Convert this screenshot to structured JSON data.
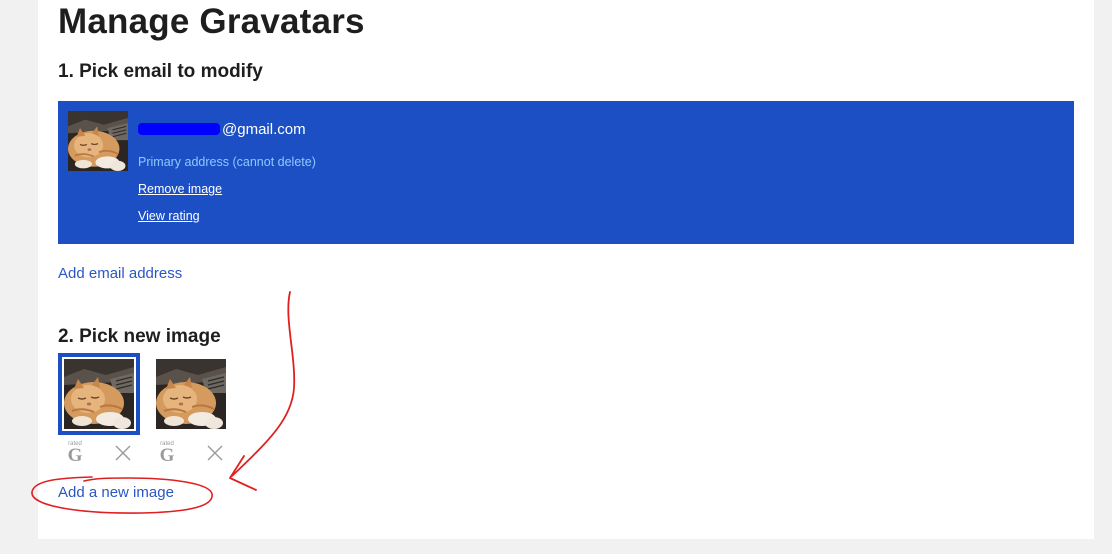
{
  "page": {
    "title": "Manage Gravatars"
  },
  "step1": {
    "heading": "1. Pick email to modify",
    "email": {
      "domain_suffix": "@gmail.com",
      "note": "Primary address (cannot delete)",
      "remove_image_label": "Remove image",
      "view_rating_label": "View rating"
    },
    "add_email_label": "Add email address"
  },
  "step2": {
    "heading": "2. Pick new image",
    "images": [
      {
        "rated_text": "rated",
        "rating": "G",
        "selected": true
      },
      {
        "rated_text": "rated",
        "rating": "G",
        "selected": false
      }
    ],
    "add_image_label": "Add a new image"
  },
  "colors": {
    "accent_blue": "#1d4fc4",
    "link_blue": "#2a56c6",
    "note_light_blue": "#8fc7ff",
    "annotation_red": "#e02020"
  }
}
